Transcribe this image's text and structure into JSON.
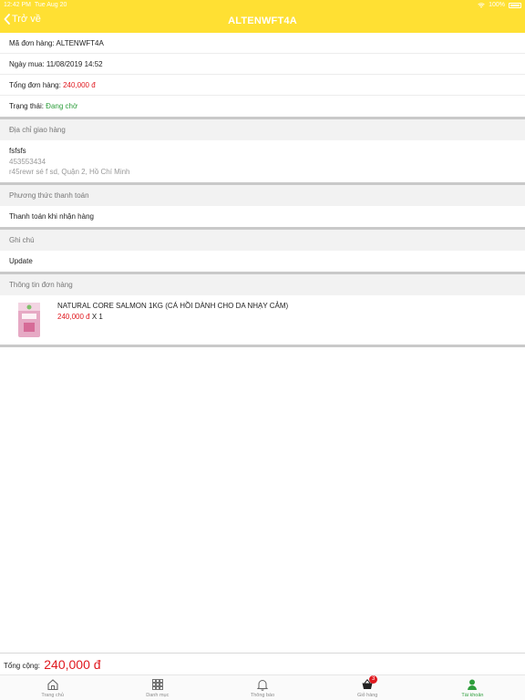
{
  "status_bar": {
    "time": "12:42 PM",
    "date": "Tue Aug 20",
    "battery": "100%"
  },
  "nav": {
    "back_label": "Trở về",
    "title": "ALTENWFT4A"
  },
  "order": {
    "code_label": "Mã đơn hàng: ",
    "code_value": "ALTENWFT4A",
    "date_label": "Ngày mua: ",
    "date_value": "11/08/2019 14:52",
    "total_label": "Tổng đơn hàng: ",
    "total_value": "240,000 đ",
    "status_label": "Trạng thái: ",
    "status_value": "Đang chờ"
  },
  "shipping": {
    "heading": "Địa chỉ giao hàng",
    "name": "fsfsfs",
    "phone": "453553434",
    "address": "r45rewr sé f sd, Quận 2, Hồ Chí Minh"
  },
  "payment": {
    "heading": "Phương thức thanh toán",
    "method": "Thanh toán khi nhận hàng"
  },
  "note": {
    "heading": "Ghi chú",
    "text": "Update"
  },
  "items_section": {
    "heading": "Thông tin đơn hàng",
    "items": [
      {
        "name": "NATURAL CORE SALMON 1KG (CÁ HỒI DÀNH CHO DA NHẠY CẢM)",
        "price": "240,000 đ",
        "qty": "X 1"
      }
    ]
  },
  "footer": {
    "total_label": "Tổng cộng:",
    "total_value": "240,000 đ"
  },
  "tabbar": {
    "tabs": [
      {
        "label": "Trang chủ",
        "icon": "home-icon"
      },
      {
        "label": "Danh mục",
        "icon": "grid-icon"
      },
      {
        "label": "Thông báo",
        "icon": "bell-icon"
      },
      {
        "label": "Giỏ hàng",
        "icon": "cart-icon",
        "badge": "3"
      },
      {
        "label": "Tài khoản",
        "icon": "user-icon",
        "active": true
      }
    ]
  },
  "colors": {
    "header": "#ffe033",
    "price_red": "#e0191f",
    "status_green": "#2e9e3c"
  }
}
